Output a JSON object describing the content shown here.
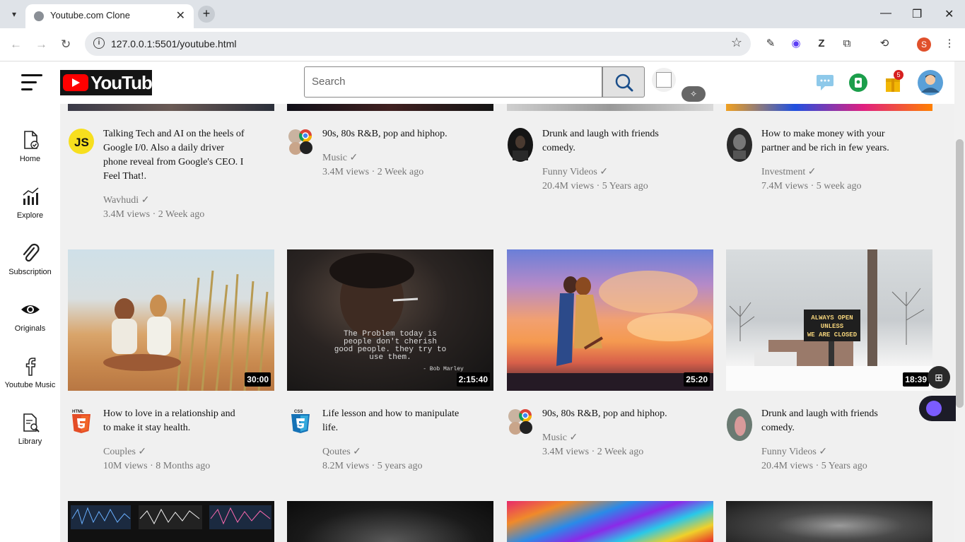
{
  "browser": {
    "tab_title": "Youtube.com Clone",
    "tab_close": "✕",
    "new_tab": "+",
    "url": "127.0.0.1:5501/youtube.html",
    "profile_initial": "S"
  },
  "header": {
    "logo_text": "YouTube",
    "search_placeholder": "Search",
    "notification_count": "5"
  },
  "sidebar": {
    "items": [
      {
        "label": "Home",
        "icon": "document-check-icon"
      },
      {
        "label": "Explore",
        "icon": "chart-icon"
      },
      {
        "label": "Subscription",
        "icon": "paperclip-icon"
      },
      {
        "label": "Originals",
        "icon": "eye-icon"
      },
      {
        "label": "Youtube Music",
        "icon": "facebook-icon"
      },
      {
        "label": "Library",
        "icon": "document-search-icon"
      }
    ]
  },
  "videos_row1": [
    {
      "title_lines": [
        "Talking Tech and AI on the heels of",
        "Google I/0. Also a daily driver",
        "phone reveal from Google's CEO. I",
        "Feel That!."
      ],
      "channel": "Wavhudi ✓",
      "meta": "3.4M views · 2 Week ago",
      "avatar": "js-logo"
    },
    {
      "title_lines": [
        "90s, 80s R&B, pop and hiphop."
      ],
      "channel": "Music ✓",
      "meta": "3.4M views · 2 Week ago",
      "avatar": "chrome-logo"
    },
    {
      "title_lines": [
        "Drunk and laugh with friends",
        "comedy."
      ],
      "channel": "Funny Videos ✓",
      "meta": "20.4M views · 5 Years ago",
      "avatar": "person-photo"
    },
    {
      "title_lines": [
        "How to make money with your",
        "partner and be rich in few years."
      ],
      "channel": "Investment ✓",
      "meta": "7.4M views · 5 week ago",
      "avatar": "person-photo"
    }
  ],
  "videos_row2": [
    {
      "title_lines": [
        "How to love in a relationship and",
        "to make it stay health."
      ],
      "channel": "Couples ✓",
      "meta": "10M views · 8 Months ago",
      "duration": "30:00",
      "avatar": "html5-logo"
    },
    {
      "title_lines": [
        "Life lesson and how to manipulate",
        "life."
      ],
      "channel": "Qoutes ✓",
      "meta": "8.2M views · 5 years ago",
      "duration": "2:15:40",
      "avatar": "css3-logo",
      "thumb_text": [
        "The Problem today is",
        "people don't cherish",
        "good people. they try to",
        "use them."
      ],
      "thumb_attr": "- Bob Marley"
    },
    {
      "title_lines": [
        "90s, 80s R&B, pop and hiphop."
      ],
      "channel": "Music ✓",
      "meta": "3.4M views · 2 Week ago",
      "duration": "25:20",
      "avatar": "chrome-logo"
    },
    {
      "title_lines": [
        "Drunk and laugh with friends",
        "comedy."
      ],
      "channel": "Funny Videos ✓",
      "meta": "20.4M views · 5 Years ago",
      "duration": "18:39",
      "avatar": "person-photo",
      "thumb_text": [
        "ALWAYS OPEN",
        "UNLESS",
        "WE ARE CLOSED"
      ]
    }
  ],
  "avatar_js_text": "JS"
}
